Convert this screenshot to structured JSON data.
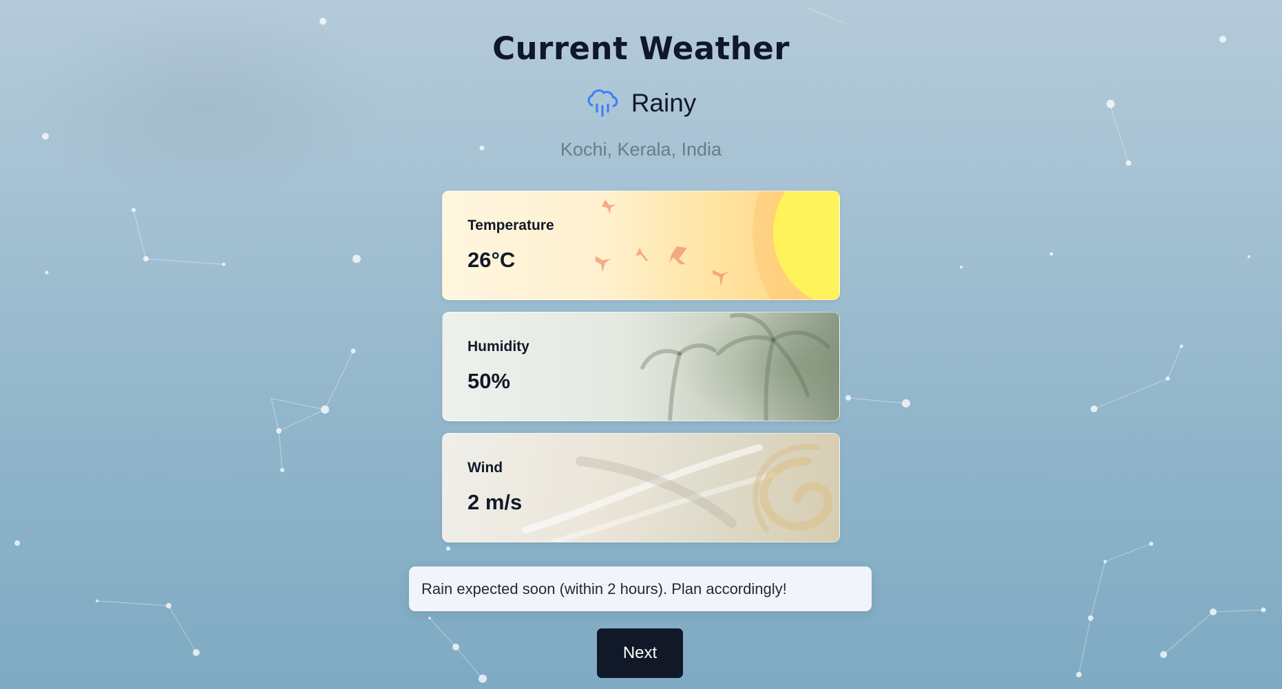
{
  "header": {
    "title": "Current Weather"
  },
  "condition": {
    "label": "Rainy",
    "icon": "cloud-rain-icon",
    "icon_color": "#3b82f6"
  },
  "location": "Kochi, Kerala, India",
  "cards": {
    "temperature": {
      "label": "Temperature",
      "value": "26°C"
    },
    "humidity": {
      "label": "Humidity",
      "value": "50%"
    },
    "wind": {
      "label": "Wind",
      "value": "2 m/s"
    }
  },
  "alert": {
    "message": "Rain expected soon (within 2 hours). Plan accordingly!"
  },
  "actions": {
    "next_label": "Next"
  },
  "colors": {
    "primary_button": "#111827",
    "background_top": "#b4cad8",
    "background_bottom": "#7eaac3"
  }
}
